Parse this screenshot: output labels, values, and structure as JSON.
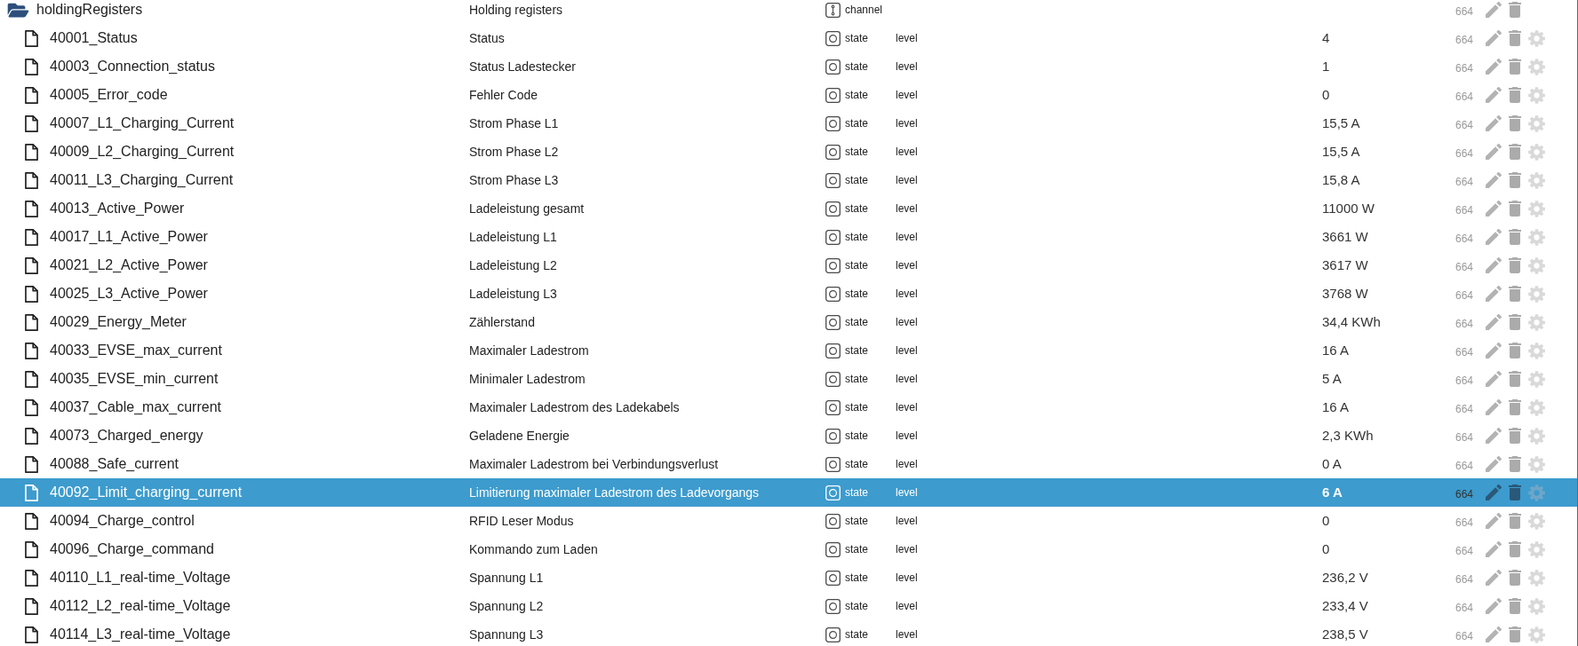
{
  "objects": [
    {
      "kind": "channel",
      "name": "holdingRegisters",
      "description": "Holding registers",
      "type": "channel",
      "acl": "664",
      "expanded": true,
      "selected": false,
      "children": [
        {
          "kind": "state",
          "name": "40001_Status",
          "description": "Status",
          "type": "state",
          "role": "level",
          "value": "4",
          "acl": "664",
          "selected": false
        },
        {
          "kind": "state",
          "name": "40003_Connection_status",
          "description": "Status Ladestecker",
          "type": "state",
          "role": "level",
          "value": "1",
          "acl": "664",
          "selected": false
        },
        {
          "kind": "state",
          "name": "40005_Error_code",
          "description": "Fehler Code",
          "type": "state",
          "role": "level",
          "value": "0",
          "acl": "664",
          "selected": false
        },
        {
          "kind": "state",
          "name": "40007_L1_Charging_Current",
          "description": "Strom Phase L1",
          "type": "state",
          "role": "level",
          "value": "15,5 A",
          "acl": "664",
          "selected": false
        },
        {
          "kind": "state",
          "name": "40009_L2_Charging_Current",
          "description": "Strom Phase L2",
          "type": "state",
          "role": "level",
          "value": "15,5 A",
          "acl": "664",
          "selected": false
        },
        {
          "kind": "state",
          "name": "40011_L3_Charging_Current",
          "description": "Strom Phase L3",
          "type": "state",
          "role": "level",
          "value": "15,8 A",
          "acl": "664",
          "selected": false
        },
        {
          "kind": "state",
          "name": "40013_Active_Power",
          "description": "Ladeleistung gesamt",
          "type": "state",
          "role": "level",
          "value": "11000 W",
          "acl": "664",
          "selected": false
        },
        {
          "kind": "state",
          "name": "40017_L1_Active_Power",
          "description": "Ladeleistung L1",
          "type": "state",
          "role": "level",
          "value": "3661 W",
          "acl": "664",
          "selected": false
        },
        {
          "kind": "state",
          "name": "40021_L2_Active_Power",
          "description": "Ladeleistung L2",
          "type": "state",
          "role": "level",
          "value": "3617 W",
          "acl": "664",
          "selected": false
        },
        {
          "kind": "state",
          "name": "40025_L3_Active_Power",
          "description": "Ladeleistung L3",
          "type": "state",
          "role": "level",
          "value": "3768 W",
          "acl": "664",
          "selected": false
        },
        {
          "kind": "state",
          "name": "40029_Energy_Meter",
          "description": "Zählerstand",
          "type": "state",
          "role": "level",
          "value": "34,4 KWh",
          "acl": "664",
          "selected": false
        },
        {
          "kind": "state",
          "name": "40033_EVSE_max_current",
          "description": "Maximaler Ladestrom",
          "type": "state",
          "role": "level",
          "value": "16 A",
          "acl": "664",
          "selected": false
        },
        {
          "kind": "state",
          "name": "40035_EVSE_min_current",
          "description": "Minimaler Ladestrom",
          "type": "state",
          "role": "level",
          "value": "5 A",
          "acl": "664",
          "selected": false
        },
        {
          "kind": "state",
          "name": "40037_Cable_max_current",
          "description": "Maximaler Ladestrom des Ladekabels",
          "type": "state",
          "role": "level",
          "value": "16 A",
          "acl": "664",
          "selected": false
        },
        {
          "kind": "state",
          "name": "40073_Charged_energy",
          "description": "Geladene Energie",
          "type": "state",
          "role": "level",
          "value": "2,3 KWh",
          "acl": "664",
          "selected": false
        },
        {
          "kind": "state",
          "name": "40088_Safe_current",
          "description": "Maximaler Ladestrom bei Verbindungsverlust",
          "type": "state",
          "role": "level",
          "value": "0 A",
          "acl": "664",
          "selected": false
        },
        {
          "kind": "state",
          "name": "40092_Limit_charging_current",
          "description": "Limitierung maximaler Ladestrom des Ladevorgangs",
          "type": "state",
          "role": "level",
          "value": "6 A",
          "acl": "664",
          "selected": true
        },
        {
          "kind": "state",
          "name": "40094_Charge_control",
          "description": "RFID Leser Modus",
          "type": "state",
          "role": "level",
          "value": "0",
          "acl": "664",
          "selected": false
        },
        {
          "kind": "state",
          "name": "40096_Charge_command",
          "description": "Kommando zum Laden",
          "type": "state",
          "role": "level",
          "value": "0",
          "acl": "664",
          "selected": false
        },
        {
          "kind": "state",
          "name": "40110_L1_real-time_Voltage",
          "description": "Spannung L1",
          "type": "state",
          "role": "level",
          "value": "236,2 V",
          "acl": "664",
          "selected": false
        },
        {
          "kind": "state",
          "name": "40112_L2_real-time_Voltage",
          "description": "Spannung L2",
          "type": "state",
          "role": "level",
          "value": "233,4 V",
          "acl": "664",
          "selected": false
        },
        {
          "kind": "state",
          "name": "40114_L3_real-time_Voltage",
          "description": "Spannung L3",
          "type": "state",
          "role": "level",
          "value": "238,5 V",
          "acl": "664",
          "selected": false
        }
      ]
    }
  ]
}
